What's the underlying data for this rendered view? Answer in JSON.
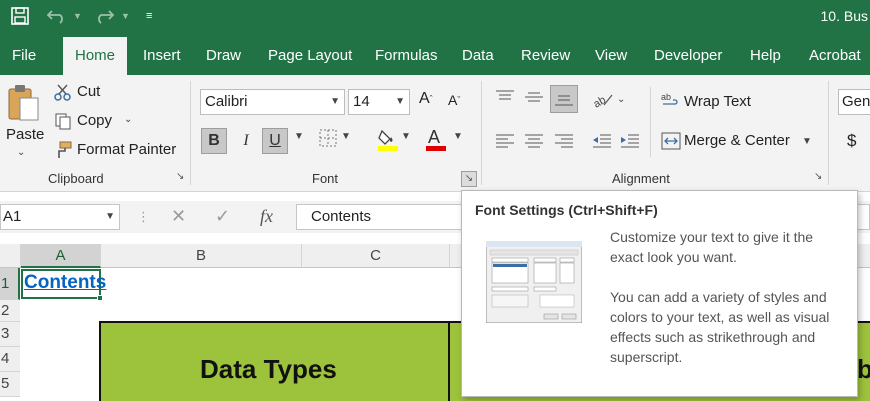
{
  "app": {
    "document_title": "10. Bus",
    "accent_color": "#217346"
  },
  "tabs": [
    "File",
    "Home",
    "Insert",
    "Draw",
    "Page Layout",
    "Formulas",
    "Data",
    "Review",
    "View",
    "Developer",
    "Help",
    "Acrobat"
  ],
  "clipboard": {
    "paste_label": "Paste",
    "cut_label": "Cut",
    "copy_label": "Copy",
    "format_painter_label": "Format Painter",
    "group_label": "Clipboard"
  },
  "font": {
    "family": "Calibri",
    "size": "14",
    "group_label": "Font",
    "bold": "B",
    "italic": "I",
    "underline": "U",
    "fill_color": "#ffff00",
    "font_color": "#e00000"
  },
  "alignment": {
    "wrap_text_label": "Wrap Text",
    "merge_center_label": "Merge & Center",
    "group_label": "Alignment"
  },
  "number": {
    "format": "Gene",
    "currency_symbol": "$"
  },
  "formula_bar": {
    "name_box": "A1",
    "fx": "fx",
    "value": "Contents"
  },
  "columns": [
    "A",
    "B",
    "C"
  ],
  "rows": [
    "1",
    "2",
    "3",
    "4",
    "5"
  ],
  "cells": {
    "a1": "Contents",
    "heading": "Data Types",
    "partial_heading": "b"
  },
  "tooltip": {
    "title": "Font Settings (Ctrl+Shift+F)",
    "paragraph1": "Customize your text to give it the exact look you want.",
    "paragraph2": "You can add a variety of styles and colors to your text, as well as visual effects such as strikethrough and superscript."
  }
}
